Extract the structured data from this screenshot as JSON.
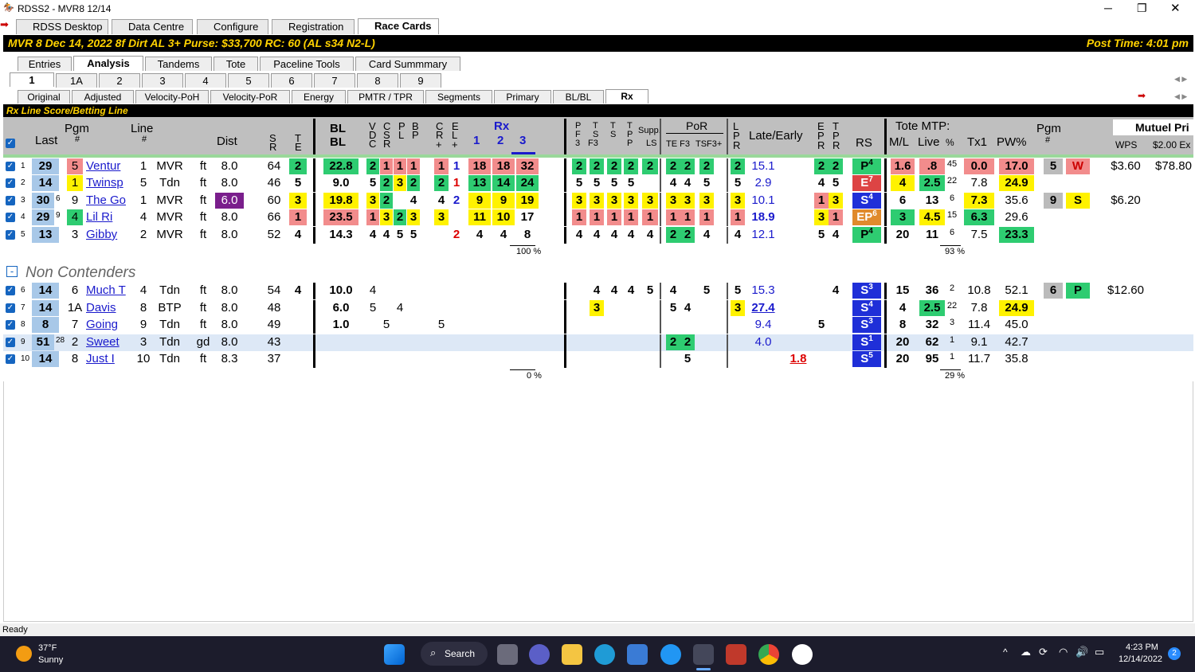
{
  "window": {
    "title": "RDSS2 - MVR8 12/14",
    "minimize": "─",
    "maximize": "❐",
    "close": "✕"
  },
  "main_tabs": [
    "RDSS Desktop",
    "Data Centre",
    "Configure",
    "Registration",
    "Race Cards"
  ],
  "race_header": {
    "left": "MVR  8   Dec 14, 2022         8f  Dirt   AL  3+   Purse: $33,700   RC: 60  (AL s34 N2-L)",
    "right": "Post Time: 4:01 pm"
  },
  "view_tabs": [
    "Entries",
    "Analysis",
    "Tandems",
    "Tote",
    "Paceline Tools",
    "Card Summmary"
  ],
  "race_tabs": [
    "1",
    "1A",
    "2",
    "3",
    "4",
    "5",
    "6",
    "7",
    "8",
    "9"
  ],
  "report_tabs": [
    "Original",
    "Adjusted",
    "Velocity-PoH",
    "Velocity-PoR",
    "Energy",
    "PMTR / TPR",
    "Segments",
    "Primary",
    "BL/BL",
    "Rx"
  ],
  "section_title": "Rx Line Score/Betting Line",
  "col_headers": {
    "pgm": "Pgm",
    "pgm_hash": "#",
    "last": "Last",
    "line": "Line",
    "line_hash": "#",
    "dist": "Dist",
    "sr_s": "S",
    "sr_r": "R",
    "te_t": "T",
    "te_e": "E",
    "bl1": "BL",
    "bl2": "BL",
    "v": "V",
    "d": "D",
    "c": "C",
    "cc": "C",
    "cs": "S",
    "cr": "R",
    "pp": "P",
    "pl": "L",
    "b": "B",
    "bp": "P",
    "c2": "C",
    "r2": "R",
    "plus1": "+",
    "e2": "E",
    "l2": "L",
    "plus2": "+",
    "rx": "Rx",
    "rx1": "1",
    "rx2": "2",
    "rx3": "3",
    "pf": "P",
    "ff": "F",
    "f3": "3",
    "ts": "T",
    "ss": "S",
    "sf3": "F3",
    "tt": "T",
    "ts2": "S",
    "tp": "T",
    "pp2": "P",
    "supp": "Supp.",
    "ls": "LS",
    "por": "PoR",
    "tef3": "TE F3",
    "tsf3": "TSF3+",
    "lpr_l": "L",
    "lpr_p": "P",
    "lpr_r": "R",
    "late": "Late/Early",
    "epr_e": "E",
    "epr_p": "P",
    "epr_r": "R",
    "tpr_t": "T",
    "tpr_p": "P",
    "tpr_r": "R",
    "rs": "RS",
    "tote": "Tote MTP:",
    "ml": "M/L",
    "live": "Live",
    "pct": "%",
    "tx1": "Tx1",
    "pwpct": "PW%",
    "pgm2": "Pgm",
    "pgm2_hash": "#",
    "mutuel": "Mutuel Pri",
    "wps": "WPS",
    "ex": "$2.00 Ex"
  },
  "contenders": [
    {
      "n": "1",
      "last": "29",
      "lsup": "",
      "pgm": "5",
      "name": "Ventur",
      "line": "1",
      "trk": "MVR",
      "sf": "ft",
      "dist": "8.0",
      "sr": "64",
      "te": "2",
      "bl": "22.8",
      "v": "2",
      "c": "1",
      "p": "1",
      "b": "1",
      "cr": "1",
      "el": "1",
      "rx1": "18",
      "rx2": "18",
      "rx3": "32",
      "pf": "2",
      "ts": "2",
      "tt": "2",
      "tp": "2",
      "supp": "2",
      "por1": "2",
      "por2": "2",
      "por3": "2",
      "lpr": "2",
      "late": "15.1",
      "ep": "2",
      "tpr": "2",
      "rs": "P",
      "rsn": "4",
      "ml": "1.6",
      "live": ".8",
      "pct": "45",
      "tx1": "0.0",
      "pw": "17.0",
      "pg2": "5",
      "pos": "W",
      "wps": "$3.60",
      "ex": "$78.80"
    },
    {
      "n": "2",
      "last": "14",
      "lsup": "",
      "pgm": "1",
      "name": "Twinsp",
      "line": "5",
      "trk": "Tdn",
      "sf": "ft",
      "dist": "8.0",
      "sr": "46",
      "te": "5",
      "bl": "9.0",
      "v": "5",
      "c": "2",
      "p": "3",
      "b": "2",
      "cr": "2",
      "el": "1",
      "rx1": "13",
      "rx2": "14",
      "rx3": "24",
      "pf": "5",
      "ts": "5",
      "tt": "5",
      "tp": "5",
      "supp": "",
      "por1": "4",
      "por2": "4",
      "por3": "5",
      "lpr": "5",
      "late": "2.9",
      "ep": "4",
      "tpr": "5",
      "rs": "E",
      "rsn": "7",
      "ml": "4",
      "live": "2.5",
      "pct": "22",
      "tx1": "7.8",
      "pw": "24.9",
      "pg2": "",
      "pos": "",
      "wps": "",
      "ex": ""
    },
    {
      "n": "3",
      "last": "30",
      "lsup": "6",
      "pgm": "9",
      "name": "The Go",
      "line": "1",
      "trk": "MVR",
      "sf": "ft",
      "dist": "6.0",
      "sr": "60",
      "te": "3",
      "bl": "19.8",
      "v": "3",
      "c": "2",
      "p": "",
      "b": "4",
      "cr": "4",
      "el": "2",
      "rx1": "9",
      "rx2": "9",
      "rx3": "19",
      "pf": "3",
      "ts": "3",
      "tt": "3",
      "tp": "3",
      "supp": "3",
      "por1": "3",
      "por2": "3",
      "por3": "3",
      "lpr": "3",
      "late": "10.1",
      "ep": "1",
      "tpr": "3",
      "rs": "S",
      "rsn": "4",
      "ml": "6",
      "live": "13",
      "pct": "6",
      "tx1": "7.3",
      "pw": "35.6",
      "pg2": "9",
      "pos": "S",
      "wps": "$6.20",
      "ex": ""
    },
    {
      "n": "4",
      "last": "29",
      "lsup": "9",
      "pgm": "4",
      "name": "Lil Ri",
      "line": "4",
      "trk": "MVR",
      "sf": "ft",
      "dist": "8.0",
      "sr": "66",
      "te": "1",
      "bl": "23.5",
      "v": "1",
      "c": "3",
      "p": "2",
      "b": "3",
      "cr": "3",
      "el": "",
      "rx1": "11",
      "rx2": "10",
      "rx3": "17",
      "pf": "1",
      "ts": "1",
      "tt": "1",
      "tp": "1",
      "supp": "1",
      "por1": "1",
      "por2": "1",
      "por3": "1",
      "lpr": "1",
      "late": "18.9",
      "ep": "3",
      "tpr": "1",
      "rs": "EP",
      "rsn": "6",
      "ml": "3",
      "live": "4.5",
      "pct": "15",
      "tx1": "6.3",
      "pw": "29.6",
      "pg2": "",
      "pos": "",
      "wps": "",
      "ex": ""
    },
    {
      "n": "5",
      "last": "13",
      "lsup": "",
      "pgm": "3",
      "name": "Gibby",
      "line": "2",
      "trk": "MVR",
      "sf": "ft",
      "dist": "8.0",
      "sr": "52",
      "te": "4",
      "bl": "14.3",
      "v": "4",
      "c": "4",
      "p": "5",
      "b": "5",
      "cr": "",
      "el": "2",
      "rx1": "4",
      "rx2": "4",
      "rx3": "8",
      "pf": "4",
      "ts": "4",
      "tt": "4",
      "tp": "4",
      "supp": "4",
      "por1": "2",
      "por2": "2",
      "por3": "4",
      "lpr": "4",
      "late": "12.1",
      "ep": "5",
      "tpr": "4",
      "rs": "P",
      "rsn": "4",
      "ml": "20",
      "live": "11",
      "pct": "6",
      "tx1": "7.5",
      "pw": "23.3",
      "pg2": "",
      "pos": "",
      "wps": "",
      "ex": ""
    }
  ],
  "contender_totals": {
    "rx": "100 %",
    "pct": "93 %"
  },
  "noncontenders_label": "Non Contenders",
  "noncontenders": [
    {
      "n": "6",
      "last": "14",
      "lsup": "",
      "pgm": "6",
      "name": "Much T",
      "line": "4",
      "trk": "Tdn",
      "sf": "ft",
      "dist": "8.0",
      "sr": "54",
      "te": "4",
      "bl": "10.0",
      "v": "4",
      "c": "",
      "p": "",
      "b": "",
      "cr": "",
      "ts": "4",
      "tt": "4",
      "tp": "4",
      "supp": "5",
      "pf": "",
      "por1": "4",
      "por2": "",
      "por3": "5",
      "lpr": "5",
      "late": "15.3",
      "early": "",
      "ep": "",
      "tpr": "4",
      "rs": "S",
      "rsn": "3",
      "ml": "15",
      "live": "36",
      "pct": "2",
      "tx1": "10.8",
      "pw": "52.1",
      "pg2": "6",
      "pos": "P",
      "wps": "$12.60"
    },
    {
      "n": "7",
      "last": "14",
      "lsup": "",
      "pgm": "1A",
      "name": "Davis",
      "line": "8",
      "trk": "BTP",
      "sf": "ft",
      "dist": "8.0",
      "sr": "48",
      "te": "",
      "bl": "6.0",
      "v": "5",
      "c": "",
      "p": "4",
      "b": "",
      "cr": "",
      "ts": "3",
      "tt": "",
      "tp": "",
      "supp": "",
      "pf": "",
      "por1": "5",
      "por2": "4",
      "por3": "",
      "lpr": "3",
      "late": "27.4",
      "early": "",
      "ep": "",
      "tpr": "",
      "rs": "S",
      "rsn": "4",
      "ml": "4",
      "live": "2.5",
      "pct": "22",
      "tx1": "7.8",
      "pw": "24.9",
      "pg2": "",
      "pos": "",
      "wps": ""
    },
    {
      "n": "8",
      "last": "8",
      "lsup": "",
      "pgm": "7",
      "name": "Going",
      "line": "9",
      "trk": "Tdn",
      "sf": "ft",
      "dist": "8.0",
      "sr": "49",
      "te": "",
      "bl": "1.0",
      "v": "",
      "c": "5",
      "p": "",
      "b": "",
      "cr": "5",
      "ts": "",
      "tt": "",
      "tp": "",
      "supp": "",
      "pf": "",
      "por1": "",
      "por2": "",
      "por3": "",
      "lpr": "",
      "late": "9.4",
      "early": "",
      "ep": "5",
      "tpr": "",
      "rs": "S",
      "rsn": "3",
      "ml": "8",
      "live": "32",
      "pct": "3",
      "tx1": "11.4",
      "pw": "45.0",
      "pg2": "",
      "pos": "",
      "wps": ""
    },
    {
      "n": "9",
      "last": "51",
      "lsup": "28",
      "pgm": "2",
      "name": "Sweet",
      "line": "3",
      "trk": "Tdn",
      "sf": "gd",
      "dist": "8.0",
      "sr": "43",
      "te": "",
      "bl": "",
      "v": "",
      "c": "",
      "p": "",
      "b": "",
      "cr": "",
      "ts": "",
      "tt": "",
      "tp": "",
      "supp": "",
      "pf": "",
      "por1": "2",
      "por2": "2",
      "por3": "",
      "lpr": "",
      "late": "4.0",
      "early": "",
      "ep": "",
      "tpr": "",
      "rs": "S",
      "rsn": "1",
      "ml": "20",
      "live": "62",
      "pct": "1",
      "tx1": "9.1",
      "pw": "42.7",
      "pg2": "",
      "pos": "",
      "wps": ""
    },
    {
      "n": "10",
      "last": "14",
      "lsup": "",
      "pgm": "8",
      "name": "Just I",
      "line": "10",
      "trk": "Tdn",
      "sf": "ft",
      "dist": "8.3",
      "sr": "37",
      "te": "",
      "bl": "",
      "v": "",
      "c": "",
      "p": "",
      "b": "",
      "cr": "",
      "ts": "",
      "tt": "",
      "tp": "",
      "supp": "",
      "pf": "",
      "por1": "",
      "por2": "5",
      "por3": "",
      "lpr": "",
      "late": "",
      "early": "1.8",
      "ep": "",
      "tpr": "",
      "rs": "S",
      "rsn": "5",
      "ml": "20",
      "live": "95",
      "pct": "1",
      "tx1": "11.7",
      "pw": "35.8",
      "pg2": "",
      "pos": "",
      "wps": ""
    }
  ],
  "noncontender_totals": {
    "rx": "0 %",
    "pct": "29 %"
  },
  "status": "Ready",
  "taskbar": {
    "temp": "37°F",
    "weather": "Sunny",
    "search": "Search",
    "time": "4:23 PM",
    "date": "12/14/2022",
    "notif": "2"
  }
}
